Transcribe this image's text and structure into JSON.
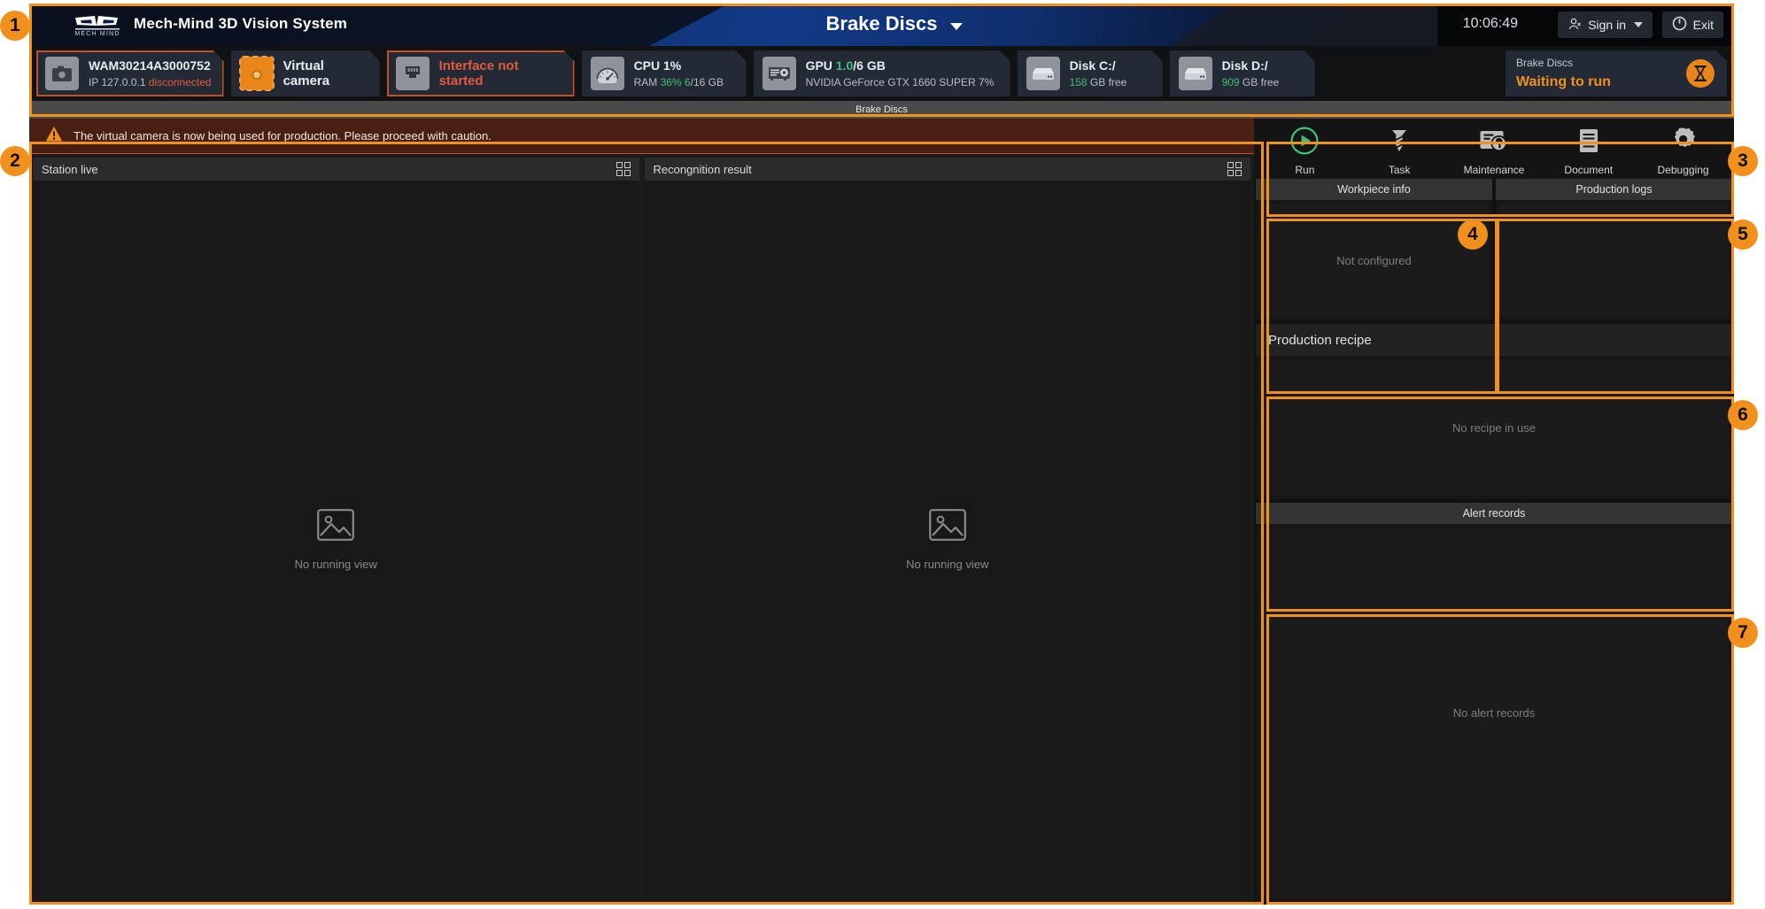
{
  "titlebar": {
    "app_name": "Mech-Mind 3D Vision System",
    "logo_text": "MECH MIND",
    "project_title": "Brake Discs",
    "clock": "10:06:49",
    "sign_in_label": "Sign in",
    "exit_label": "Exit"
  },
  "status_cards": [
    {
      "id": "camera-real",
      "icon": "camera-icon",
      "icon_style": "grey",
      "line1": "WAM30214A3000752",
      "line2_prefix": "IP 127.0.0.1 ",
      "line2_status": "disconnected",
      "status_color": "#e05b3c",
      "alert": true
    },
    {
      "id": "virtual-camera",
      "icon": "camera-icon",
      "icon_style": "orange",
      "single_line": "Virtual camera",
      "single_color": "#e9edf3",
      "alert": false
    },
    {
      "id": "interface",
      "icon": "ethernet-icon",
      "icon_style": "grey",
      "single_line": "Interface not started",
      "single_color": "#e05b3c",
      "alert": true
    },
    {
      "id": "cpu",
      "icon": "gauge-icon",
      "icon_style": "grey",
      "line1": "CPU 1%",
      "ram_label": "RAM ",
      "ram_pct": "36%",
      "ram_used": " 6",
      "ram_total": "/16 GB",
      "alert": false
    },
    {
      "id": "gpu",
      "icon": "gpu-card-icon",
      "icon_style": "grey",
      "gpu_label": "GPU ",
      "gpu_used": "1.0",
      "gpu_total": "/6 GB",
      "line2": "NVIDIA GeForce GTX 1660 SUPER 7%",
      "alert": false
    },
    {
      "id": "disk-c",
      "icon": "disk-icon",
      "icon_style": "grey",
      "line1": "Disk C:/",
      "free_value": "158",
      "free_suffix": " GB free",
      "alert": false
    },
    {
      "id": "disk-d",
      "icon": "disk-icon",
      "icon_style": "grey",
      "line1": "Disk D:/",
      "free_value": "909",
      "free_suffix": " GB free",
      "alert": false
    }
  ],
  "run_card": {
    "project": "Brake Discs",
    "state": "Waiting to run",
    "badge_icon": "hourglass-icon",
    "accent": "#F2901E"
  },
  "tabstrip": {
    "active_tab": "Brake Discs"
  },
  "warning": {
    "icon": "warning-triangle-icon",
    "message": "The virtual camera is now being used for production. Please proceed with caution."
  },
  "viewports": [
    {
      "id": "station-live",
      "title": "Station live",
      "empty_text": "No running view",
      "grid_icon": "grid-layout-icon",
      "placeholder_icon": "image-placeholder-icon"
    },
    {
      "id": "recognition-result",
      "title": "Recongnition result",
      "empty_text": "No running view",
      "grid_icon": "grid-layout-icon",
      "placeholder_icon": "image-placeholder-icon"
    }
  ],
  "toolbar": [
    {
      "id": "run",
      "label": "Run",
      "icon": "play-circle-icon",
      "color": "#3FBF79"
    },
    {
      "id": "task",
      "label": "Task",
      "icon": "screw-icon",
      "color": "#bdbdbd"
    },
    {
      "id": "maintenance",
      "label": "Maintenance",
      "icon": "maintenance-wrench-icon",
      "color": "#bdbdbd"
    },
    {
      "id": "document",
      "label": "Document",
      "icon": "document-icon",
      "color": "#bdbdbd"
    },
    {
      "id": "debugging",
      "label": "Debugging",
      "icon": "gear-icon",
      "color": "#bdbdbd"
    }
  ],
  "panels": {
    "workpiece_info": {
      "title": "Workpiece info",
      "empty_text": "Not configured"
    },
    "production_logs": {
      "title": "Production logs",
      "empty_text": ""
    },
    "production_recipe": {
      "title": "Production recipe",
      "empty_text": "No recipe in use"
    },
    "alert_records": {
      "title": "Alert records",
      "empty_text": "No alert records"
    }
  },
  "annotations": [
    {
      "num": "1"
    },
    {
      "num": "2"
    },
    {
      "num": "3"
    },
    {
      "num": "4"
    },
    {
      "num": "5"
    },
    {
      "num": "6"
    },
    {
      "num": "7"
    }
  ]
}
